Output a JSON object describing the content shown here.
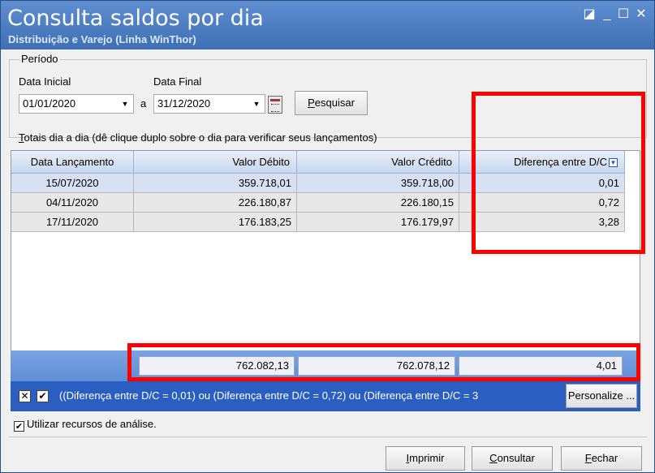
{
  "window": {
    "title": "Consulta saldos por dia",
    "subtitle": "Distribuição e Varejo (Linha WinThor)",
    "controls": {
      "restore": "◪",
      "minimize": "_",
      "maximize": "☐",
      "close": "✕"
    }
  },
  "periodo": {
    "legend": "Período",
    "data_inicial_label": "Data Inicial",
    "data_final_label": "Data Final",
    "data_inicial": "01/01/2020",
    "data_final": "31/12/2020",
    "separator": "a",
    "pesquisar": {
      "accel": "P",
      "rest": "esquisar"
    }
  },
  "grid": {
    "caption_accel": "T",
    "caption_rest": "otais dia a dia (dê clique duplo sobre o dia para verificar seus lançamentos)",
    "columns": [
      "Data Lançamento",
      "Valor Débito",
      "Valor Crédito",
      "Diferença entre D/C"
    ],
    "rows": [
      [
        "15/07/2020",
        "359.718,01",
        "359.718,00",
        "0,01"
      ],
      [
        "04/11/2020",
        "226.180,87",
        "226.180,15",
        "0,72"
      ],
      [
        "17/11/2020",
        "176.183,25",
        "176.179,97",
        "3,28"
      ]
    ],
    "totals": [
      "762.082,13",
      "762.078,12",
      "4,01"
    ]
  },
  "filter": {
    "clear_mark": "✕",
    "enabled_mark": "✔",
    "text": "((Diferença entre D/C = 0,01) ou (Diferença entre D/C = 0,72) ou (Diferença entre D/C = 3",
    "personalize_label": "Personalize ..."
  },
  "analysis": {
    "label": "Utilizar recursos de análise.",
    "check_mark": "✔"
  },
  "buttons": {
    "imprimir": {
      "accel": "I",
      "rest": "mprimir"
    },
    "consultar": {
      "accel": "C",
      "rest": "onsultar"
    },
    "fechar": {
      "accel": "F",
      "rest": "echar"
    }
  },
  "colors": {
    "titlebar": "#4a7cc2",
    "highlight": "#ff0000",
    "filterbar": "#2a5fc1"
  }
}
